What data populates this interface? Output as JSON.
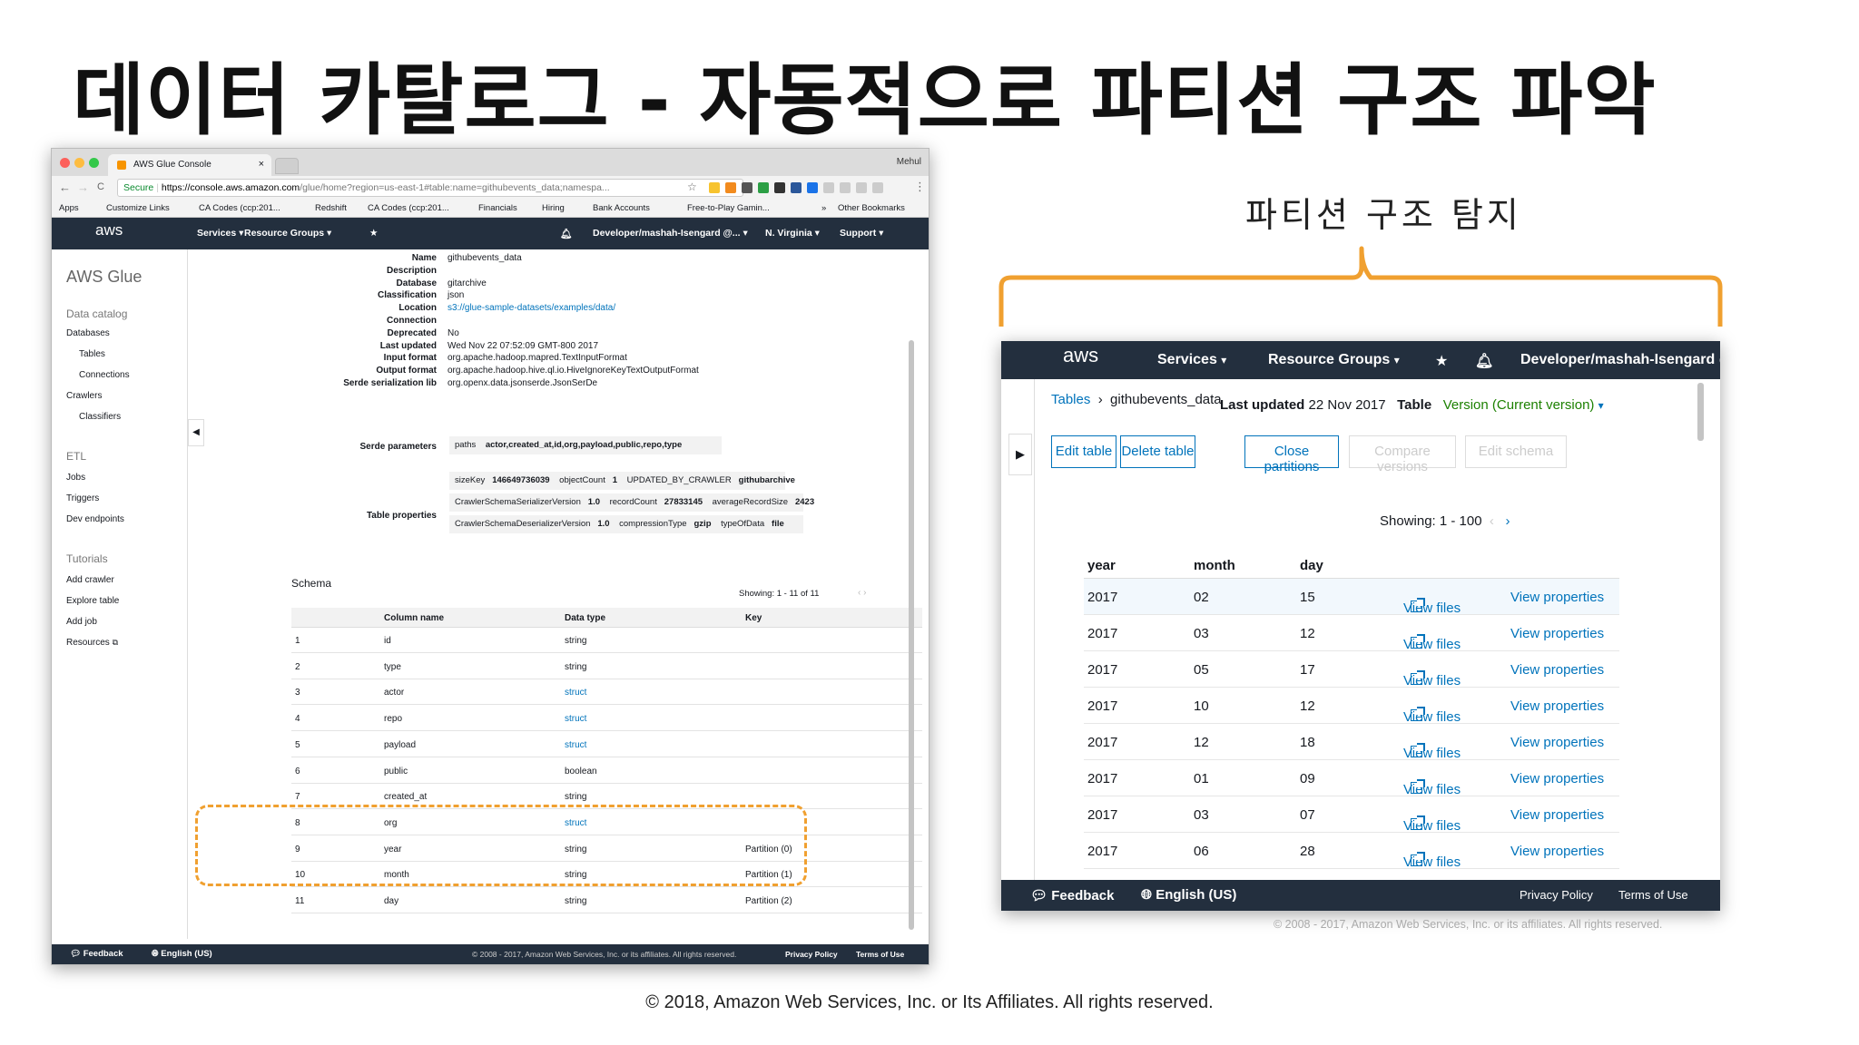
{
  "slide": {
    "title": "데이터 카탈로그 - 자동적으로 파티션 구조 파악",
    "footer": "© 2018, Amazon Web Services, Inc. or Its Affiliates. All rights reserved.",
    "right_label": "파티션 구조 탐지",
    "accent_color": "#f0a030"
  },
  "browser": {
    "tab_title": "AWS Glue Console",
    "tab_close": "×",
    "user": "Mehul",
    "secure": "Secure",
    "url_host": "https://console.aws.amazon.com",
    "url_rest": "/glue/home?region=us-east-1#table:name=githubevents_data;namespa...",
    "nav_back": "←",
    "nav_forward": "→",
    "nav_reload": "C",
    "bookmarks": [
      "Apps",
      "Customize Links",
      "CA Codes (ccp:201...",
      "Redshift",
      "CA Codes (ccp:201...",
      "Financials",
      "Hiring",
      "Bank Accounts",
      "Free-to-Play Gamin...",
      "»",
      "Other Bookmarks"
    ]
  },
  "awsnav": {
    "logo": "aws",
    "services": "Services",
    "resource_groups": "Resource Groups",
    "pin": "★",
    "user": "Developer/mashah-Isengard @...",
    "region": "N. Virginia",
    "support": "Support",
    "caret": "▾"
  },
  "sidebar": {
    "title": "AWS Glue",
    "collapse": "◀",
    "sections": [
      {
        "heading": "Data catalog",
        "items": [
          "Databases",
          "Tables",
          "Connections",
          "Crawlers",
          "Classifiers"
        ]
      },
      {
        "heading": "ETL",
        "items": [
          "Jobs",
          "Triggers",
          "Dev endpoints"
        ]
      },
      {
        "heading": "Tutorials",
        "items": [
          "Add crawler",
          "Explore table",
          "Add job",
          "Resources"
        ]
      }
    ]
  },
  "table_details": {
    "props": [
      {
        "label": "Name",
        "value": "githubevents_data"
      },
      {
        "label": "Description",
        "value": ""
      },
      {
        "label": "Database",
        "value": "gitarchive"
      },
      {
        "label": "Classification",
        "value": "json"
      },
      {
        "label": "Location",
        "value": "s3://glue-sample-datasets/examples/data/"
      },
      {
        "label": "Connection",
        "value": ""
      },
      {
        "label": "Deprecated",
        "value": "No"
      },
      {
        "label": "Last updated",
        "value": "Wed Nov 22 07:52:09 GMT-800 2017"
      },
      {
        "label": "Input format",
        "value": "org.apache.hadoop.mapred.TextInputFormat"
      },
      {
        "label": "Output format",
        "value": "org.apache.hadoop.hive.ql.io.HiveIgnoreKeyTextOutputFormat"
      },
      {
        "label": "Serde serialization lib",
        "value": "org.openx.data.jsonserde.JsonSerDe"
      }
    ],
    "serde_label": "Serde parameters",
    "serde_key": "paths",
    "serde_value": "actor,created_at,id,org,payload,public,repo,type",
    "table_props_label": "Table properties",
    "table_props": [
      [
        [
          "sizeKey",
          "146649736039"
        ],
        [
          "objectCount",
          "1"
        ],
        [
          "UPDATED_BY_CRAWLER",
          "githubarchive"
        ]
      ],
      [
        [
          "CrawlerSchemaSerializerVersion",
          "1.0"
        ],
        [
          "recordCount",
          "27833145"
        ],
        [
          "averageRecordSize",
          "2423"
        ]
      ],
      [
        [
          "CrawlerSchemaDeserializerVersion",
          "1.0"
        ],
        [
          "compressionType",
          "gzip"
        ],
        [
          "typeOfData",
          "file"
        ]
      ]
    ]
  },
  "schema": {
    "title": "Schema",
    "showing": "Showing: 1 - 11 of 11",
    "pager": "‹  ›",
    "headers": [
      "Column name",
      "Data type",
      "Key"
    ],
    "rows": [
      {
        "n": "1",
        "name": "id",
        "type": "string",
        "key": ""
      },
      {
        "n": "2",
        "name": "type",
        "type": "string",
        "key": ""
      },
      {
        "n": "3",
        "name": "actor",
        "type": "struct",
        "key": ""
      },
      {
        "n": "4",
        "name": "repo",
        "type": "struct",
        "key": ""
      },
      {
        "n": "5",
        "name": "payload",
        "type": "struct",
        "key": ""
      },
      {
        "n": "6",
        "name": "public",
        "type": "boolean",
        "key": ""
      },
      {
        "n": "7",
        "name": "created_at",
        "type": "string",
        "key": ""
      },
      {
        "n": "8",
        "name": "org",
        "type": "struct",
        "key": ""
      },
      {
        "n": "9",
        "name": "year",
        "type": "string",
        "key": "Partition (0)"
      },
      {
        "n": "10",
        "name": "month",
        "type": "string",
        "key": "Partition (1)"
      },
      {
        "n": "11",
        "name": "day",
        "type": "string",
        "key": "Partition (2)"
      }
    ]
  },
  "bfooter": {
    "feedback": "Feedback",
    "language": "English (US)",
    "copyright": "© 2008 - 2017, Amazon Web Services, Inc. or its affiliates. All rights reserved.",
    "privacy": "Privacy Policy",
    "terms": "Terms of Use"
  },
  "partitions_panel": {
    "breadcrumb_tables": "Tables",
    "breadcrumb_sep": "›",
    "breadcrumb_current": "githubevents_data",
    "last_updated_label": "Last updated",
    "last_updated_value": "22 Nov 2017",
    "table_label": "Table",
    "version": "Version (Current version)",
    "expand": "▶",
    "buttons": [
      "Edit table",
      "Delete table",
      "Close partitions",
      "Compare versions",
      "Edit schema"
    ],
    "showing": "Showing: 1 - 100",
    "pager_prev": "‹",
    "pager_next": "›",
    "headers": [
      "year",
      "month",
      "day"
    ],
    "view_files": "View files",
    "view_properties": "View properties",
    "rows": [
      [
        "2017",
        "02",
        "15"
      ],
      [
        "2017",
        "03",
        "12"
      ],
      [
        "2017",
        "05",
        "17"
      ],
      [
        "2017",
        "10",
        "12"
      ],
      [
        "2017",
        "12",
        "18"
      ],
      [
        "2017",
        "01",
        "09"
      ],
      [
        "2017",
        "03",
        "07"
      ],
      [
        "2017",
        "06",
        "28"
      ]
    ],
    "footer_feedback": "Feedback",
    "footer_language": "English (US)",
    "footer_privacy": "Privacy Policy",
    "footer_terms": "Terms of Use",
    "copyright": "© 2008 - 2017, Amazon Web Services, Inc. or its affiliates. All rights reserved."
  }
}
